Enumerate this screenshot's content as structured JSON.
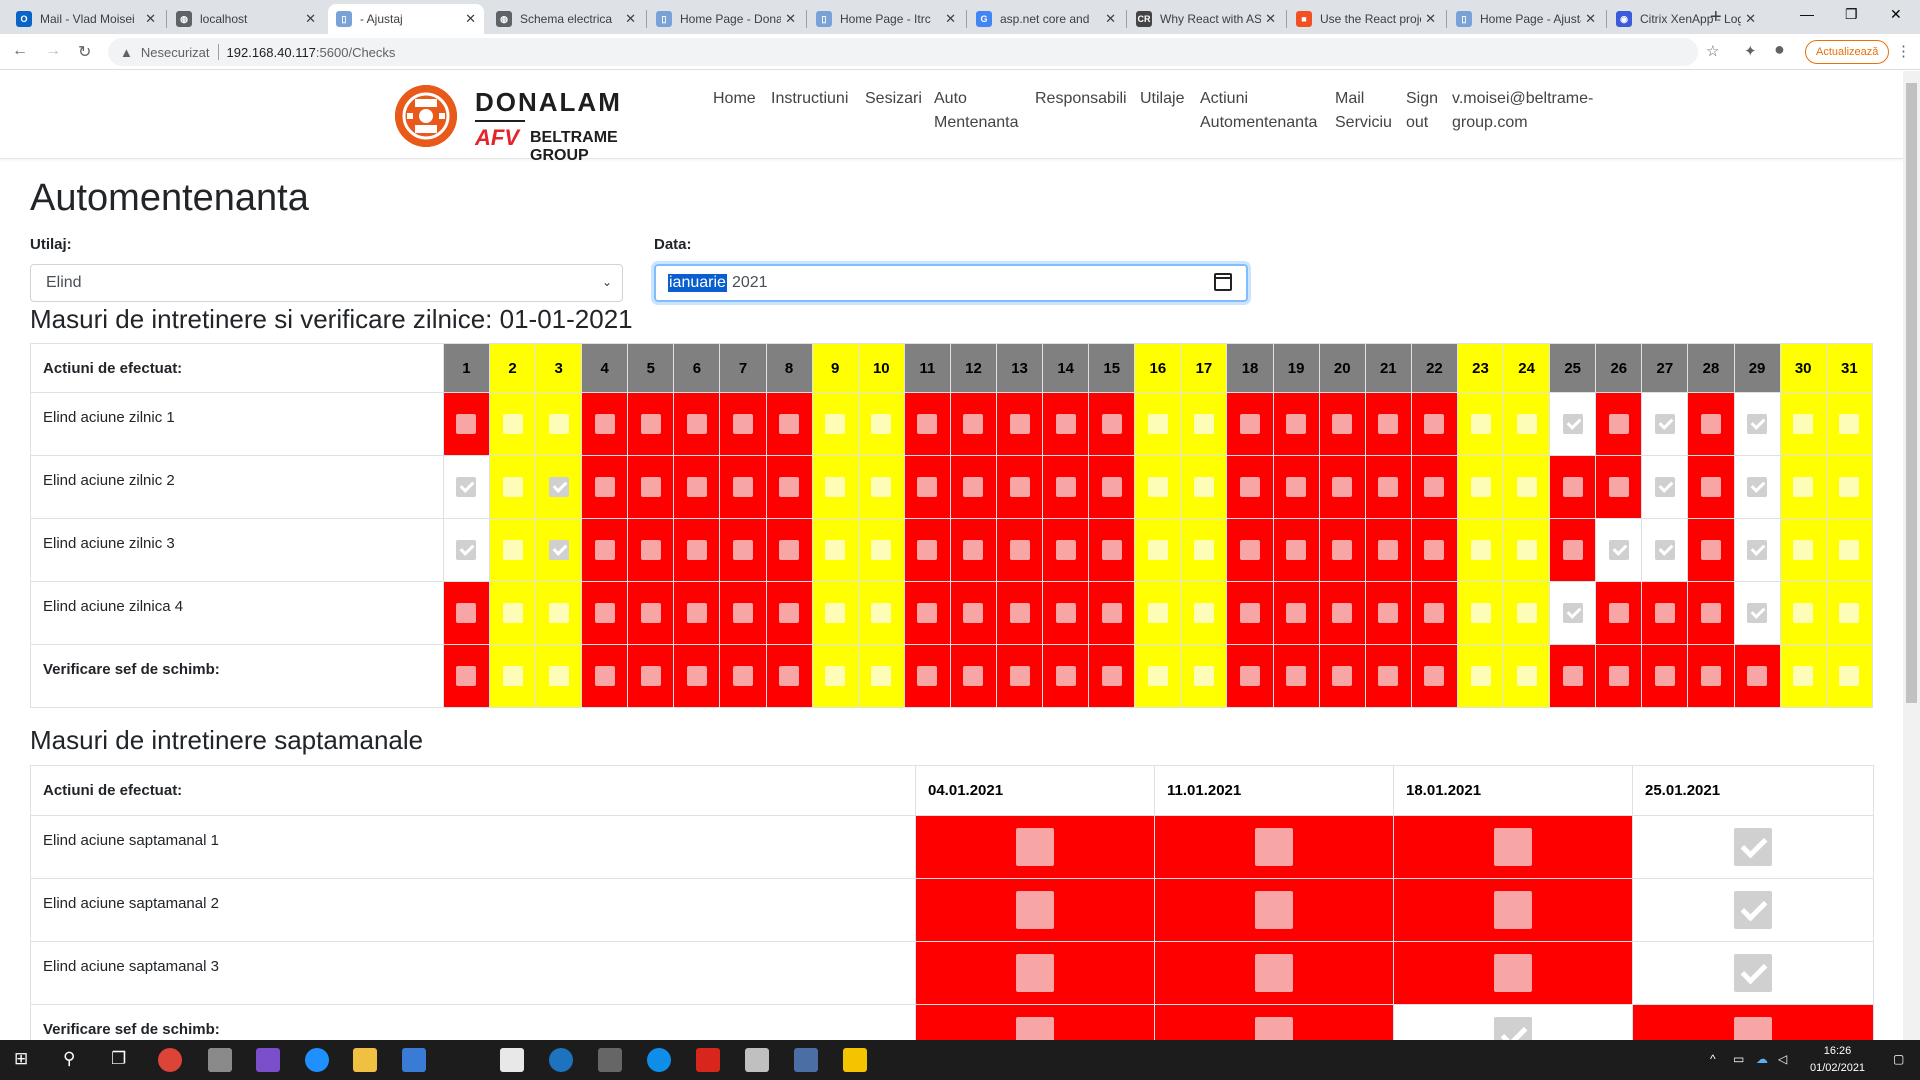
{
  "browser": {
    "tabs": [
      {
        "label": "Mail - Vlad Moisei",
        "icon": "outlook-icon",
        "color": "#0a64c8",
        "glyph": "O"
      },
      {
        "label": "localhost",
        "icon": "globe-icon",
        "color": "#5f6368",
        "glyph": "◍"
      },
      {
        "label": "- Ajustaj",
        "icon": "page-icon",
        "color": "#7aa2d6",
        "glyph": "▯",
        "active": true
      },
      {
        "label": "Schema electrica",
        "icon": "globe-icon",
        "color": "#5f6368",
        "glyph": "◍"
      },
      {
        "label": "Home Page - Donalam",
        "icon": "page-icon",
        "color": "#7aa2d6",
        "glyph": "▯"
      },
      {
        "label": "Home Page - Itrc",
        "icon": "page-icon",
        "color": "#7aa2d6",
        "glyph": "▯"
      },
      {
        "label": "asp.net core and",
        "icon": "google-icon",
        "color": "#4285f4",
        "glyph": "G"
      },
      {
        "label": "Why React with ASP",
        "icon": "cr-icon",
        "color": "#444444",
        "glyph": "CR"
      },
      {
        "label": "Use the React project",
        "icon": "microsoft-icon",
        "color": "#f25022",
        "glyph": "■"
      },
      {
        "label": "Home Page - Ajustaj",
        "icon": "page-icon",
        "color": "#7aa2d6",
        "glyph": "▯"
      },
      {
        "label": "Citrix XenApp - Login",
        "icon": "citrix-icon",
        "color": "#3b5bdb",
        "glyph": "◉"
      }
    ],
    "not_secure": "Nesecurizat",
    "url_host": "192.168.40.117",
    "url_path": ":5600/Checks",
    "update_label": "Actualizează"
  },
  "site": {
    "brand": "DONALAM",
    "sub_brand": "AFV",
    "group": "BELTRAME GROUP",
    "nav": [
      "Home",
      "Instructiuni",
      "Sesizari",
      "Auto Mentenanta",
      "Responsabili",
      "Utilaje",
      "Actiuni Automentenanta",
      "Mail Serviciu",
      "Sign out",
      "v.moisei@beltrame-group.com"
    ]
  },
  "page": {
    "title": "Automentenanta",
    "utilaj_label": "Utilaj:",
    "utilaj_value": "Elind",
    "data_label": "Data:",
    "date_month": "ianuarie",
    "date_year": "2021"
  },
  "daily": {
    "title": "Masuri de intretinere si verificare zilnice: 01-01-2021",
    "header_label": "Actiuni de efectuat:",
    "days": [
      "1",
      "2",
      "3",
      "4",
      "5",
      "6",
      "7",
      "8",
      "9",
      "10",
      "11",
      "12",
      "13",
      "14",
      "15",
      "16",
      "17",
      "18",
      "19",
      "20",
      "21",
      "22",
      "23",
      "24",
      "25",
      "26",
      "27",
      "28",
      "29",
      "30",
      "31"
    ],
    "day_colors": [
      "g",
      "y",
      "y",
      "g",
      "g",
      "g",
      "g",
      "g",
      "y",
      "y",
      "g",
      "g",
      "g",
      "g",
      "g",
      "y",
      "y",
      "g",
      "g",
      "g",
      "g",
      "g",
      "y",
      "y",
      "g",
      "g",
      "g",
      "g",
      "g",
      "y",
      "y"
    ],
    "rows": [
      {
        "label": "Elind aciune zilnic 1",
        "bold": false,
        "states": [
          "r",
          "y",
          "y",
          "r",
          "r",
          "r",
          "r",
          "r",
          "y",
          "y",
          "r",
          "r",
          "r",
          "r",
          "r",
          "y",
          "y",
          "r",
          "r",
          "r",
          "r",
          "r",
          "y",
          "y",
          "w",
          "r",
          "w",
          "r",
          "w",
          "y",
          "y"
        ]
      },
      {
        "label": "Elind aciune zilnic 2",
        "bold": false,
        "states": [
          "w",
          "y",
          "yc",
          "r",
          "r",
          "r",
          "r",
          "r",
          "y",
          "y",
          "r",
          "r",
          "r",
          "r",
          "r",
          "y",
          "y",
          "r",
          "r",
          "r",
          "r",
          "r",
          "y",
          "y",
          "r",
          "r",
          "w",
          "r",
          "w",
          "y",
          "y"
        ]
      },
      {
        "label": "Elind aciune zilnic 3",
        "bold": false,
        "states": [
          "w",
          "y",
          "yc",
          "r",
          "r",
          "r",
          "r",
          "r",
          "y",
          "y",
          "r",
          "r",
          "r",
          "r",
          "r",
          "y",
          "y",
          "r",
          "r",
          "r",
          "r",
          "r",
          "y",
          "y",
          "r",
          "w",
          "w",
          "r",
          "w",
          "y",
          "y"
        ]
      },
      {
        "label": "Elind aciune zilnica 4",
        "bold": false,
        "states": [
          "r",
          "y",
          "y",
          "r",
          "r",
          "r",
          "r",
          "r",
          "y",
          "y",
          "r",
          "r",
          "r",
          "r",
          "r",
          "y",
          "y",
          "r",
          "r",
          "r",
          "r",
          "r",
          "y",
          "y",
          "w",
          "r",
          "r",
          "r",
          "w",
          "y",
          "y"
        ]
      },
      {
        "label": "Verificare sef de schimb:",
        "bold": true,
        "states": [
          "r",
          "y",
          "y",
          "r",
          "r",
          "r",
          "r",
          "r",
          "y",
          "y",
          "r",
          "r",
          "r",
          "r",
          "r",
          "y",
          "y",
          "r",
          "r",
          "r",
          "r",
          "r",
          "y",
          "y",
          "r",
          "r",
          "r",
          "r",
          "r",
          "y",
          "y"
        ]
      }
    ]
  },
  "weekly": {
    "title": "Masuri de intretinere saptamanale",
    "header_label": "Actiuni de efectuat:",
    "weeks": [
      "04.01.2021",
      "11.01.2021",
      "18.01.2021",
      "25.01.2021"
    ],
    "rows": [
      {
        "label": "Elind aciune saptamanal 1",
        "bold": false,
        "states": [
          "r",
          "r",
          "r",
          "w"
        ]
      },
      {
        "label": "Elind aciune saptamanal 2",
        "bold": false,
        "states": [
          "r",
          "r",
          "r",
          "w"
        ]
      },
      {
        "label": "Elind aciune saptamanal 3",
        "bold": false,
        "states": [
          "r",
          "r",
          "r",
          "w"
        ]
      },
      {
        "label": "Verificare sef de schimb:",
        "bold": true,
        "states": [
          "r",
          "r",
          "w",
          "r"
        ]
      }
    ]
  },
  "taskbar": {
    "time": "16:26",
    "date": "01/02/2021"
  }
}
